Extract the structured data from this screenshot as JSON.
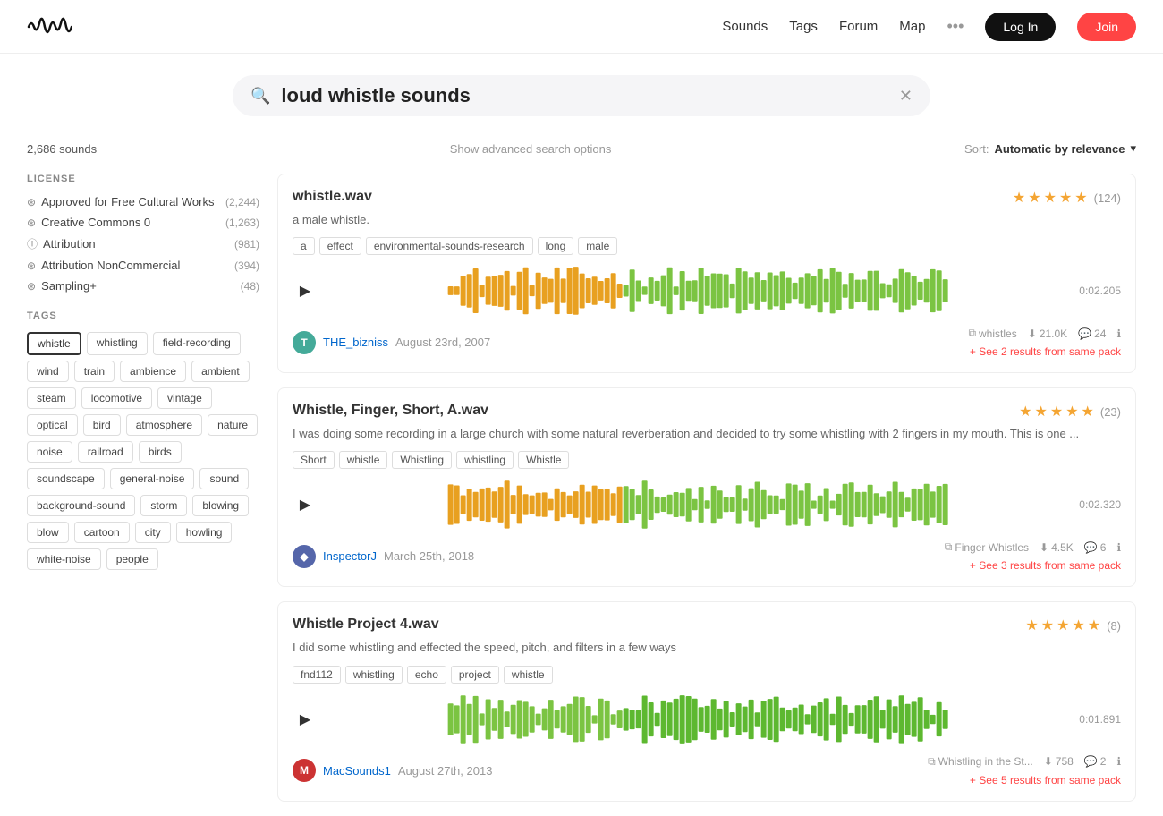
{
  "header": {
    "nav": [
      "Sounds",
      "Tags",
      "Forum",
      "Map"
    ],
    "login_label": "Log In",
    "join_label": "Join"
  },
  "search": {
    "query": "loud whistle sounds",
    "placeholder": "loud whistle sounds"
  },
  "results": {
    "count": "2,686 sounds",
    "advanced": "Show advanced search options",
    "sort_label": "Sort:",
    "sort_value": "Automatic by relevance"
  },
  "sidebar": {
    "license_title": "LICENSE",
    "licenses": [
      {
        "icon": "©",
        "label": "Approved for Free Cultural Works",
        "count": "(2,244)"
      },
      {
        "icon": "©",
        "label": "Creative Commons 0",
        "count": "(1,263)"
      },
      {
        "icon": "ⓘ",
        "label": "Attribution",
        "count": "(981)"
      },
      {
        "icon": "⊗",
        "label": "Attribution NonCommercial",
        "count": "(394)"
      },
      {
        "icon": "©",
        "label": "Sampling+",
        "count": "(48)"
      }
    ],
    "tags_title": "TAGS",
    "tags": [
      {
        "label": "whistle",
        "active": true
      },
      {
        "label": "whistling",
        "active": false
      },
      {
        "label": "field-recording",
        "active": false
      },
      {
        "label": "wind",
        "active": false
      },
      {
        "label": "train",
        "active": false
      },
      {
        "label": "ambience",
        "active": false
      },
      {
        "label": "ambient",
        "active": false
      },
      {
        "label": "steam",
        "active": false
      },
      {
        "label": "locomotive",
        "active": false
      },
      {
        "label": "vintage",
        "active": false
      },
      {
        "label": "optical",
        "active": false
      },
      {
        "label": "bird",
        "active": false
      },
      {
        "label": "atmosphere",
        "active": false
      },
      {
        "label": "nature",
        "active": false
      },
      {
        "label": "noise",
        "active": false
      },
      {
        "label": "railroad",
        "active": false
      },
      {
        "label": "birds",
        "active": false
      },
      {
        "label": "soundscape",
        "active": false
      },
      {
        "label": "general-noise",
        "active": false
      },
      {
        "label": "sound",
        "active": false
      },
      {
        "label": "background-sound",
        "active": false
      },
      {
        "label": "storm",
        "active": false
      },
      {
        "label": "blowing",
        "active": false
      },
      {
        "label": "blow",
        "active": false
      },
      {
        "label": "cartoon",
        "active": false
      },
      {
        "label": "city",
        "active": false
      },
      {
        "label": "howling",
        "active": false
      },
      {
        "label": "white-noise",
        "active": false
      },
      {
        "label": "people",
        "active": false
      }
    ]
  },
  "sounds": [
    {
      "id": 1,
      "title": "whistle.wav",
      "description": "a male whistle.",
      "tags": [
        "a",
        "effect",
        "environmental-sounds-research",
        "long",
        "male"
      ],
      "duration": "0:02.205",
      "rating": 4.5,
      "rating_count": "(124)",
      "user": "THE_bizniss",
      "user_color": "#4a9",
      "user_initial": "T",
      "date": "August 23rd, 2007",
      "pack": "whistles",
      "downloads": "21.0K",
      "comments": "24",
      "see_more": "+ See 2 results from same pack",
      "waveform_color1": "#e8a020",
      "waveform_color2": "#7bc442"
    },
    {
      "id": 2,
      "title": "Whistle, Finger, Short, A.wav",
      "description": "I was doing some recording in a large church with some natural reverberation and decided to try some whistling with 2 fingers in my mouth. This is one ...",
      "tags": [
        "Short",
        "whistle",
        "Whistling",
        "whistling",
        "Whistle"
      ],
      "duration": "0:02.320",
      "rating": 5,
      "rating_count": "(23)",
      "user": "InspectorJ",
      "user_color": "#5566aa",
      "user_initial": "◆",
      "date": "March 25th, 2018",
      "pack": "Finger Whistles",
      "downloads": "4.5K",
      "comments": "6",
      "see_more": "+ See 3 results from same pack",
      "waveform_color1": "#e8a020",
      "waveform_color2": "#7bc442"
    },
    {
      "id": 3,
      "title": "Whistle Project 4.wav",
      "description": "I did some whistling and effected the speed, pitch, and filters in a few ways",
      "tags": [
        "fnd112",
        "whistling",
        "echo",
        "project",
        "whistle"
      ],
      "duration": "0:01.891",
      "rating": 4.5,
      "rating_count": "(8)",
      "user": "MacSounds1",
      "user_color": "#cc3333",
      "user_initial": "M",
      "date": "August 27th, 2013",
      "pack": "Whistling in the St...",
      "downloads": "758",
      "comments": "2",
      "see_more": "+ See 5 results from same pack",
      "waveform_color1": "#7bc442",
      "waveform_color2": "#5db830"
    }
  ]
}
